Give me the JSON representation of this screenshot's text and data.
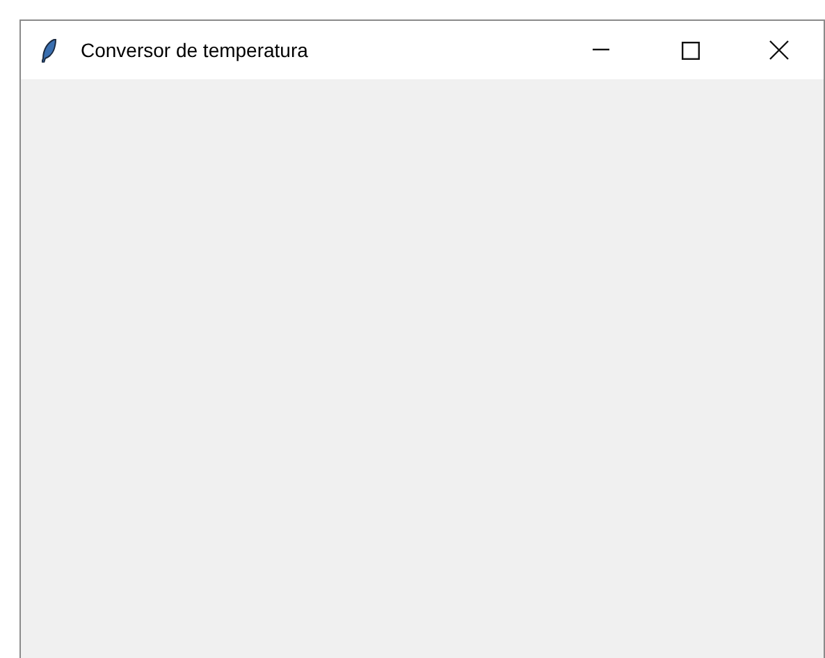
{
  "window": {
    "title": "Conversor de temperatura"
  }
}
